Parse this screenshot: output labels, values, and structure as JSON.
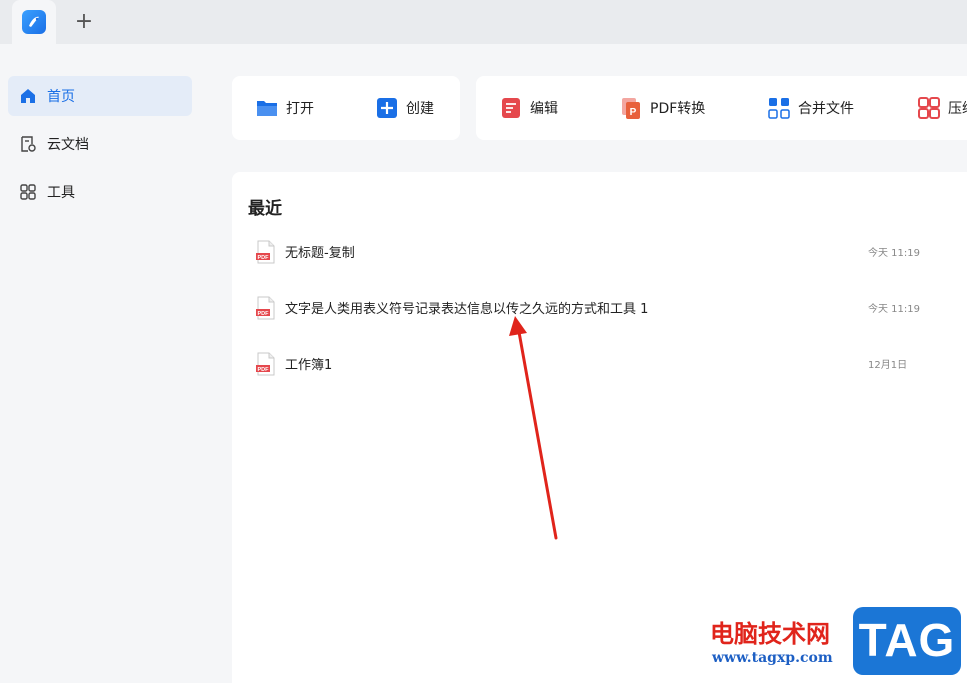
{
  "sidebar": {
    "items": [
      {
        "label": "首页",
        "icon": "home-icon",
        "active": true
      },
      {
        "label": "云文档",
        "icon": "cloud-doc-icon",
        "active": false
      },
      {
        "label": "工具",
        "icon": "grid-icon",
        "active": false
      }
    ]
  },
  "toolbar": {
    "open_label": "打开",
    "create_label": "创建",
    "edit_label": "编辑",
    "pdf_convert_label": "PDF转换",
    "merge_label": "合并文件",
    "compress_label": "压缩"
  },
  "recent": {
    "title": "最近",
    "files": [
      {
        "name": "无标题-复制",
        "time": "今天 11:19"
      },
      {
        "name": "文字是人类用表义符号记录表达信息以传之久远的方式和工具 1",
        "time": "今天 11:19"
      },
      {
        "name": "工作簿1",
        "time": "12月1日"
      }
    ]
  },
  "new_tab_label": "+",
  "watermark": {
    "site_name": "电脑技术网",
    "url": "www.tagxp.com",
    "badge": "TAG"
  },
  "colors": {
    "accent": "#1a6fe6",
    "pdf_red": "#e5484d",
    "annotation_red": "#e0241b"
  }
}
